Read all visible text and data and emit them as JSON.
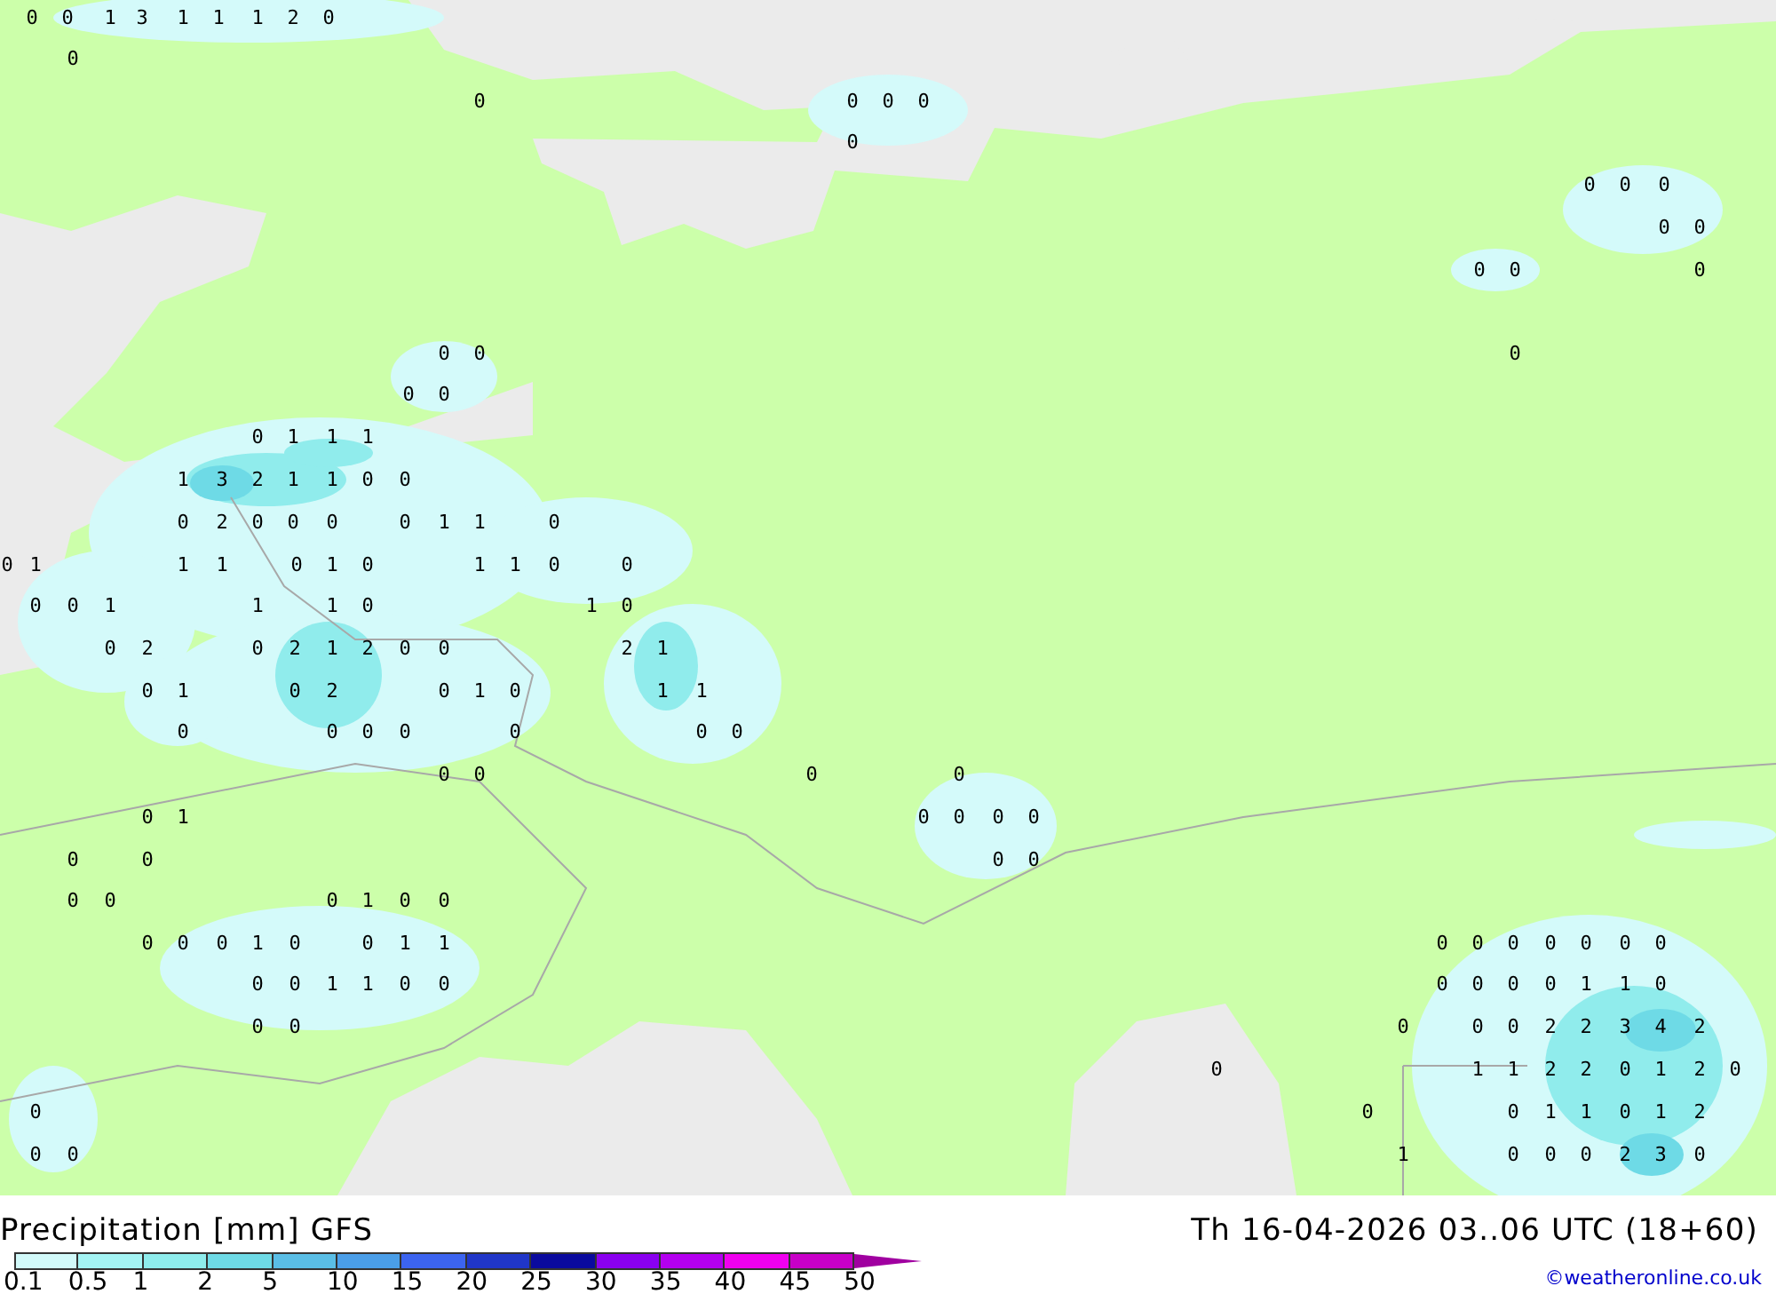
{
  "map_values": [
    [
      "0",
      "0",
      "1",
      "3",
      "1",
      "1",
      "1",
      "2",
      "0"
    ],
    [
      "0"
    ],
    [
      "0",
      "0",
      "0",
      "0"
    ],
    [
      "0"
    ],
    [
      "0",
      "0",
      "0"
    ],
    [
      "0",
      "0"
    ],
    [
      "0",
      "0",
      "0"
    ],
    [
      "0",
      "0",
      "0"
    ],
    [
      "0",
      "0"
    ],
    [
      "0",
      "1",
      "1",
      "1"
    ],
    [
      "1",
      "3",
      "2",
      "1",
      "1",
      "0",
      "0"
    ],
    [
      "0",
      "2",
      "0",
      "0",
      "0",
      "0",
      "1",
      "1",
      "0"
    ],
    [
      "0",
      "1",
      "1",
      "1",
      "0",
      "1",
      "0",
      "1",
      "1",
      "0",
      "0"
    ],
    [
      "0",
      "0",
      "1",
      "1",
      "1",
      "0",
      "1",
      "0"
    ],
    [
      "0",
      "2",
      "0",
      "2",
      "1",
      "2",
      "0",
      "0",
      "2",
      "1"
    ],
    [
      "0",
      "1",
      "0",
      "2",
      "0",
      "1",
      "0",
      "1",
      "1"
    ],
    [
      "0",
      "0",
      "0",
      "0",
      "0",
      "0",
      "0"
    ],
    [
      "0",
      "0",
      "0",
      "0"
    ],
    [
      "0",
      "1",
      "0",
      "0",
      "0",
      "0"
    ],
    [
      "0",
      "0",
      "0",
      "0"
    ],
    [
      "0",
      "0",
      "0",
      "1",
      "0",
      "0"
    ],
    [
      "0",
      "0",
      "0",
      "1",
      "0",
      "0",
      "1",
      "1",
      "0",
      "0",
      "0",
      "0",
      "0",
      "0",
      "0"
    ],
    [
      "0",
      "0",
      "1",
      "1",
      "0",
      "0",
      "0",
      "0",
      "0",
      "0",
      "1",
      "1",
      "0"
    ],
    [
      "0",
      "0",
      "0",
      "0",
      "0",
      "2",
      "2",
      "3",
      "4",
      "2"
    ],
    [
      "0",
      "1",
      "1",
      "2",
      "2",
      "0",
      "1",
      "2",
      "0"
    ],
    [
      "0",
      "0",
      "0",
      "1",
      "1",
      "0",
      "1",
      "2"
    ],
    [
      "0",
      "0",
      "1",
      "0",
      "0",
      "0",
      "2",
      "3",
      "0"
    ]
  ],
  "legend": {
    "title": "Precipitation [mm] GFS",
    "timestamp": "Th 16-04-2026 03..06 UTC (18+60)",
    "credit": "©weatheronline.co.uk",
    "scale": [
      {
        "kind": "swatch",
        "label": "0.1",
        "color": "#d2fafa"
      },
      {
        "kind": "swatch",
        "label": "0.5",
        "color": "#a4f4f4"
      },
      {
        "kind": "swatch",
        "label": "1",
        "color": "#8eecec"
      },
      {
        "kind": "swatch",
        "label": "2",
        "color": "#6edae6"
      },
      {
        "kind": "swatch",
        "label": "5",
        "color": "#5abee6"
      },
      {
        "kind": "swatch",
        "label": "10",
        "color": "#4a9ee8"
      },
      {
        "kind": "swatch",
        "label": "15",
        "color": "#3c64f0"
      },
      {
        "kind": "swatch",
        "label": "20",
        "color": "#2036c8"
      },
      {
        "kind": "swatch",
        "label": "25",
        "color": "#0a0a9e"
      },
      {
        "kind": "swatch",
        "label": "30",
        "color": "#8a00f0"
      },
      {
        "kind": "swatch",
        "label": "35",
        "color": "#b400f0"
      },
      {
        "kind": "swatch",
        "label": "40",
        "color": "#f000f0"
      },
      {
        "kind": "swatch",
        "label": "45",
        "color": "#c800c8"
      },
      {
        "kind": "arrow",
        "label": "50",
        "color": "#a000a0"
      }
    ]
  }
}
